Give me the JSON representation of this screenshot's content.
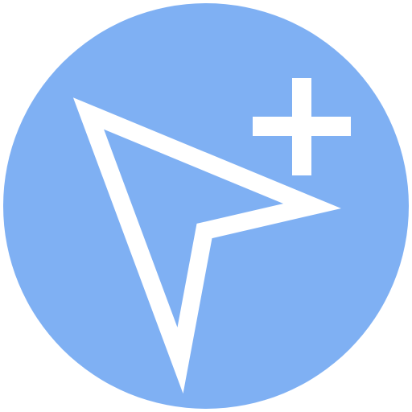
{
  "icon": {
    "name": "add-pointer-icon",
    "parts": [
      "circle-background",
      "cursor-arrow-outline",
      "plus-sign"
    ],
    "colors": {
      "background": "#7fb0f3",
      "foreground": "#ffffff"
    }
  }
}
